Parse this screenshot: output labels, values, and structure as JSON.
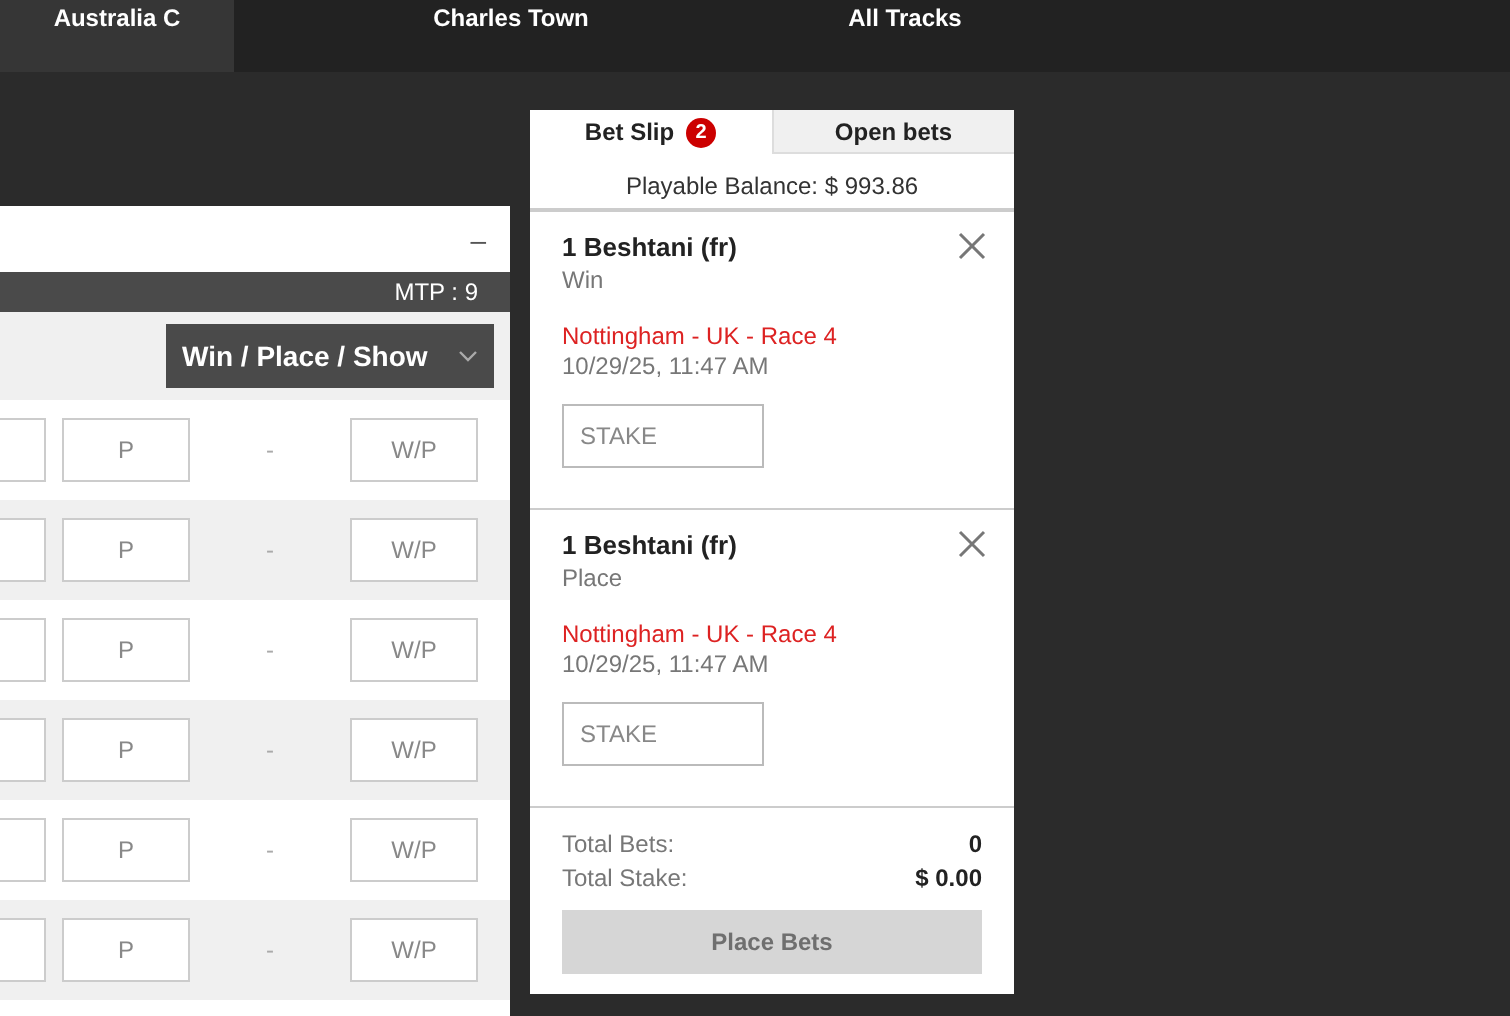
{
  "nav_tabs": [
    {
      "label": "Australia C",
      "selected": true
    },
    {
      "label": "Charles Town",
      "selected": false
    },
    {
      "label": "All Tracks",
      "selected": false
    }
  ],
  "race_panel": {
    "minimize": "–",
    "mtp": "MTP : 9",
    "bet_type": "Win / Place / Show",
    "rows": [
      {
        "place": "P",
        "separator": "-",
        "win_place": "W/P"
      },
      {
        "place": "P",
        "separator": "-",
        "win_place": "W/P"
      },
      {
        "place": "P",
        "separator": "-",
        "win_place": "W/P"
      },
      {
        "place": "P",
        "separator": "-",
        "win_place": "W/P"
      },
      {
        "place": "P",
        "separator": "-",
        "win_place": "W/P"
      },
      {
        "place": "P",
        "separator": "-",
        "win_place": "W/P"
      }
    ]
  },
  "bet_slip": {
    "tabs": [
      {
        "label": "Bet Slip",
        "badge": "2",
        "selected": true
      },
      {
        "label": "Open bets",
        "selected": false
      }
    ],
    "balance": "Playable Balance: $ 993.86",
    "bets": [
      {
        "selection": "1 Beshtani (fr)",
        "bet_type": "Win",
        "race": "Nottingham - UK - Race 4",
        "time": "10/29/25, 11:47 AM",
        "stake_placeholder": "STAKE"
      },
      {
        "selection": "1 Beshtani (fr)",
        "bet_type": "Place",
        "race": "Nottingham - UK - Race 4",
        "time": "10/29/25, 11:47 AM",
        "stake_placeholder": "STAKE"
      }
    ],
    "totals": [
      {
        "label": "Total Bets:",
        "value": "0"
      },
      {
        "label": "Total Stake:",
        "value": "$ 0.00"
      }
    ],
    "place_button": {
      "label": "Place Bets",
      "disabled": true
    }
  }
}
